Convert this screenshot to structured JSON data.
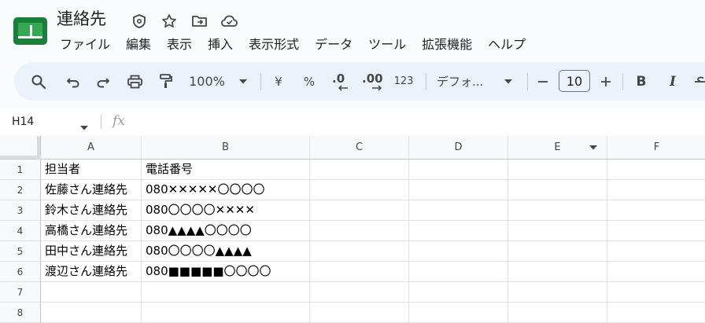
{
  "document": {
    "title": "連絡先"
  },
  "colors": {
    "logo_green": "#188038",
    "toolbar_bg": "#edf2fa",
    "page_bg": "#f9fbfd"
  },
  "title_icons": [
    "move-to-drive-icon",
    "star-icon",
    "folder-move-icon",
    "cloud-saved-icon"
  ],
  "menu": [
    "ファイル",
    "編集",
    "表示",
    "挿入",
    "表示形式",
    "データ",
    "ツール",
    "拡張機能",
    "ヘルプ"
  ],
  "toolbar": {
    "zoom": "100%",
    "currency": "¥",
    "percent": "%",
    "decimal_decrease": ".0",
    "decimal_increase": ".00",
    "number_format": "123",
    "font": "デフォ...",
    "font_size": "10",
    "bold": "B",
    "italic": "I"
  },
  "formula_bar": {
    "name_box": "H14",
    "fx": "fx"
  },
  "columns": [
    "A",
    "B",
    "C",
    "D",
    "E",
    "F"
  ],
  "rows": [
    "1",
    "2",
    "3",
    "4",
    "5",
    "6",
    "7",
    "8"
  ],
  "cells": [
    [
      "担当者",
      "電話番号"
    ],
    [
      "佐藤さん連絡先",
      "080✕✕✕✕✕〇〇〇〇"
    ],
    [
      "鈴木さん連絡先",
      "080〇〇〇〇✕✕✕✕"
    ],
    [
      "高橋さん連絡先",
      "080▲▲▲▲〇〇〇〇"
    ],
    [
      "田中さん連絡先",
      "080〇〇〇〇▲▲▲▲"
    ],
    [
      "渡辺さん連絡先",
      "080■■■■■〇〇〇〇"
    ],
    [
      "",
      ""
    ],
    [
      "",
      ""
    ]
  ]
}
